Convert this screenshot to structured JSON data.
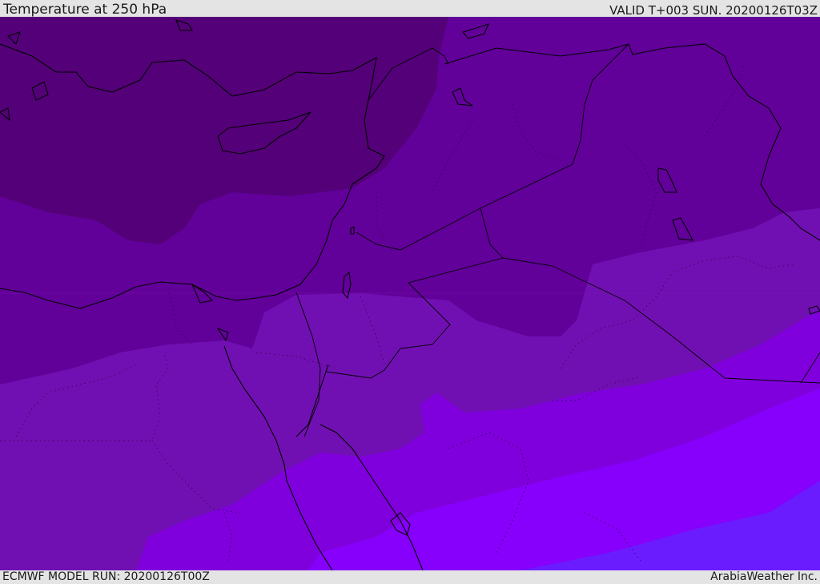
{
  "header": {
    "title": "Temperature at 250 hPa",
    "valid_time": "VALID T+003 SUN. 20200126T03Z"
  },
  "footer": {
    "model_run": "ECMWF MODEL RUN: 20200126T00Z",
    "credit": "ArabiaWeather Inc."
  },
  "colors": {
    "band_coldest": "#540078",
    "band_2": "#62009a",
    "band_3": "#7110b2",
    "band_4": "#7f00dc",
    "band_5": "#8600fb",
    "band_warmest": "#6a1cff",
    "coastline": "#000000",
    "border_dotted": "#2a0040"
  }
}
